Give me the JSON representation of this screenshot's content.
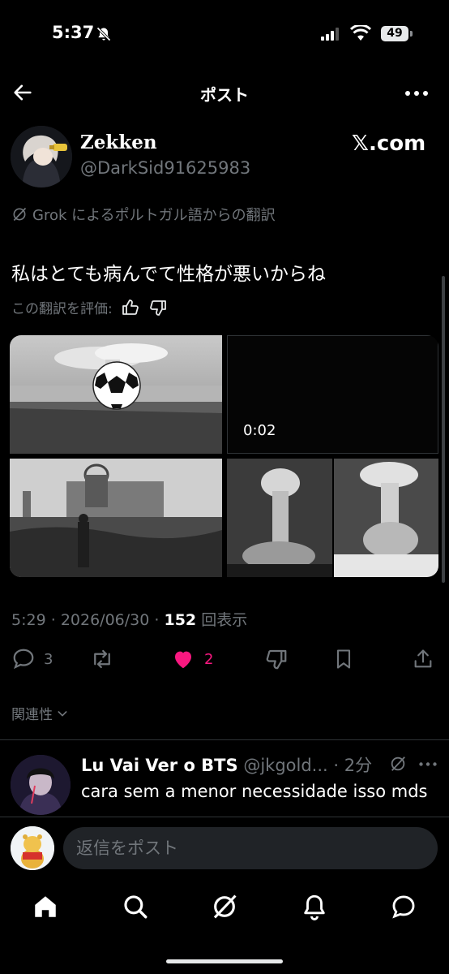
{
  "status_bar": {
    "time": "5:37",
    "battery": "49"
  },
  "nav": {
    "title": "ポスト"
  },
  "post": {
    "user_name": "Zekken",
    "user_handle": "@DarkSid91625983",
    "brand_label": "𝕏.com",
    "translation_note": "Grok によるポルトガル語からの翻訳",
    "text": "私はとても病んでて性格が悪いからね",
    "rate_prompt": "この翻訳を評価:",
    "video_duration": "0:02",
    "time": "5:29",
    "date": "2026/06/30",
    "views_count": "152",
    "views_label": "回表示",
    "reply_count": "3",
    "like_count": "2"
  },
  "relevance_label": "関連性",
  "reply": {
    "name": "Lu Vai Ver o BTS",
    "handle": "@jkgold...",
    "time": "2分",
    "text": "cara sem a menor necessidade isso mds"
  },
  "compose": {
    "placeholder": "返信をポスト"
  },
  "colors": {
    "accent": "#f91880",
    "text": "#e7e9ea",
    "muted": "#71767b",
    "input_bg": "#202327"
  },
  "icons": [
    "back-arrow-icon",
    "more-icon",
    "grok-icon",
    "thumbs-up-icon",
    "thumbs-down-icon",
    "reply-icon",
    "repost-icon",
    "heart-icon",
    "bookmark-icon",
    "share-icon",
    "chevron-down-icon",
    "home-icon",
    "search-icon",
    "notifications-icon",
    "messages-icon"
  ]
}
